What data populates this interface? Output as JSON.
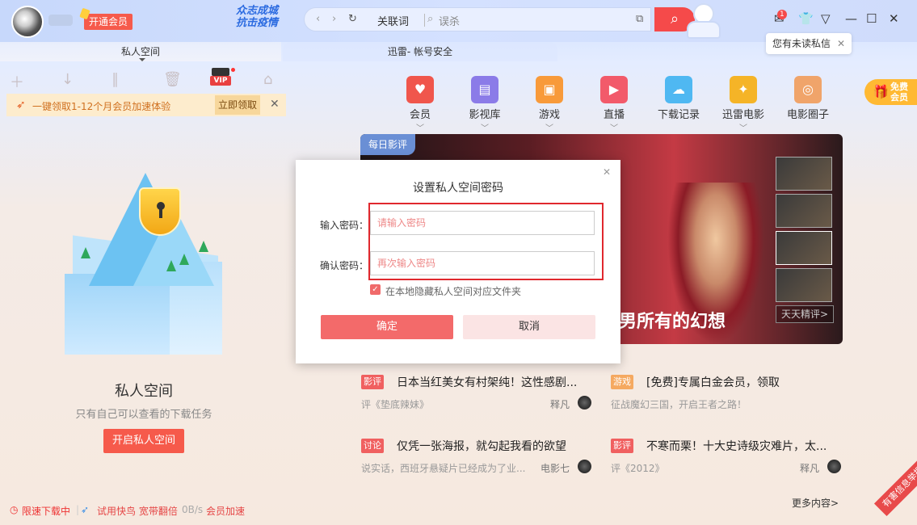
{
  "header": {
    "vip_open": "开通会员",
    "slogan_line1": "众志成城",
    "slogan_line2": "抗击疫情",
    "addr_label": "关联词",
    "addr_input": "误杀",
    "unread_tip": "您有未读私信",
    "msg_count": "1"
  },
  "tabs": [
    {
      "label": "私人空间"
    },
    {
      "label": "迅雷- 帐号安全"
    }
  ],
  "promo": {
    "text": "一键领取1-12个月会员加速体验",
    "button": "立即领取"
  },
  "left": {
    "title": "私人空间",
    "subtitle": "只有自己可以查看的下载任务",
    "button": "开启私人空间"
  },
  "statusbar": {
    "limit": "限速下载中",
    "trial": "试用快鸟 宽带翻倍",
    "speed": "0B/s",
    "accel": "会员加速"
  },
  "categories": [
    {
      "label": "会员",
      "color": "#f0564c"
    },
    {
      "label": "影视库",
      "color": "#8b7be8"
    },
    {
      "label": "游戏",
      "color": "#f89a3a"
    },
    {
      "label": "直播",
      "color": "#f25a6a"
    },
    {
      "label": "下载记录",
      "color": "#4fb8f2"
    },
    {
      "label": "迅雷电影",
      "color": "#f5b427"
    },
    {
      "label": "电影圈子",
      "color": "#f0a46a"
    }
  ],
  "free_vip": {
    "line1": "免费",
    "line2": "会员"
  },
  "banner": {
    "tag": "每日影评",
    "caption": "男所有的幻想",
    "more": "天天精评>"
  },
  "news": [
    {
      "badge": "影评",
      "badge_color": "#f06060",
      "title": "日本当红美女有村架纯！这性感剧...",
      "sub": "评《垫底辣妹》",
      "author": "释凡"
    },
    {
      "badge": "游戏",
      "badge_color": "#f5a960",
      "title": "[免费]专属白金会员，领取",
      "sub": "征战魔幻三国，开启王者之路！",
      "author": ""
    },
    {
      "badge": "讨论",
      "badge_color": "#f06060",
      "title": "仅凭一张海报，就勾起我看的欲望",
      "sub": "说实话，西班牙悬疑片已经成为了业...",
      "author": "电影七"
    },
    {
      "badge": "影评",
      "badge_color": "#f06060",
      "title": "不寒而栗！十大史诗级灾难片，太...",
      "sub": "评《2012》",
      "author": "释凡"
    }
  ],
  "more_content": "更多内容>",
  "ribbon": "有害信息举报",
  "dialog": {
    "title": "设置私人空间密码",
    "label_pwd": "输入密码：",
    "placeholder_pwd": "请输入密码",
    "label_confirm": "确认密码：",
    "placeholder_confirm": "再次输入密码",
    "checkbox": "在本地隐藏私人空间对应文件夹",
    "ok": "确定",
    "cancel": "取消"
  }
}
